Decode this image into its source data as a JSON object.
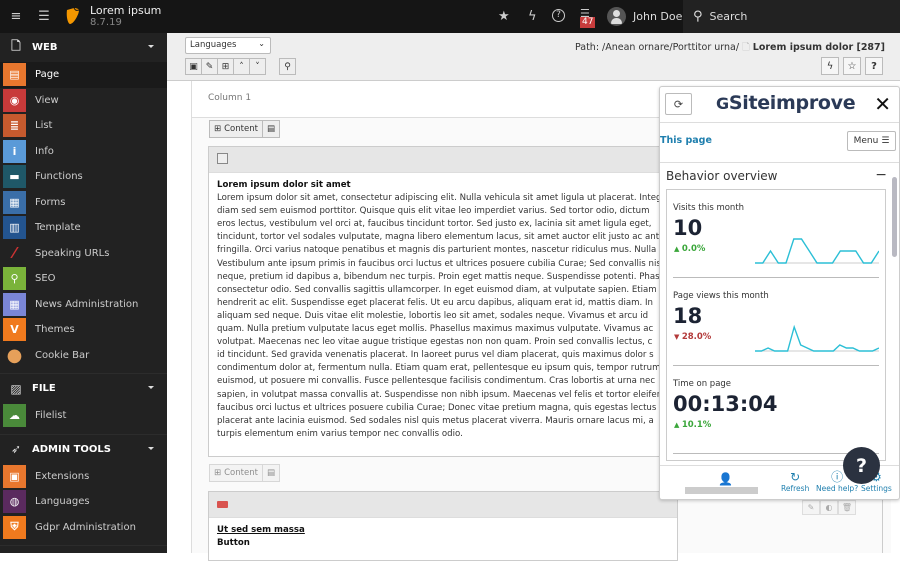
{
  "topbar": {
    "app_name": "Lorem ipsum",
    "version": "8.7.19",
    "notification_count": "47",
    "user_name": "John Doe",
    "search_label": "Search",
    "icons": [
      "menu-toggle-icon",
      "tree-toggle-icon",
      "bookmark-star-icon",
      "flash-icon",
      "help-icon",
      "system-info-icon",
      "avatar-icon",
      "search-icon"
    ]
  },
  "sidebar": {
    "sections": [
      {
        "label": "WEB",
        "icon": "page-icon",
        "items": [
          {
            "label": "Page",
            "icon": "page-module-icon",
            "color": "#e8772e",
            "active": true
          },
          {
            "label": "View",
            "icon": "eye-icon",
            "color": "#c83a3a"
          },
          {
            "label": "List",
            "icon": "list-icon",
            "color": "#c65a2e"
          },
          {
            "label": "Info",
            "icon": "info-icon",
            "color": "#5a9ad8"
          },
          {
            "label": "Functions",
            "icon": "briefcase-icon",
            "color": "#1f5868"
          },
          {
            "label": "Forms",
            "icon": "form-icon",
            "color": "#3a6ea8"
          },
          {
            "label": "Template",
            "icon": "template-icon",
            "color": "#23548f"
          },
          {
            "label": "Speaking URLs",
            "icon": "pill-icon",
            "color": "#222"
          },
          {
            "label": "SEO",
            "icon": "magnifier-icon",
            "color": "#7ab33a"
          },
          {
            "label": "News Administration",
            "icon": "newspaper-icon",
            "color": "#7a86d6"
          },
          {
            "label": "Themes",
            "icon": "typo3-icon",
            "color": "#f07a1e"
          },
          {
            "label": "Cookie Bar",
            "icon": "cookie-icon",
            "color": "#222"
          }
        ]
      },
      {
        "label": "FILE",
        "icon": "image-icon",
        "items": [
          {
            "label": "Filelist",
            "icon": "cloud-icon",
            "color": "#4a8a3a"
          }
        ]
      },
      {
        "label": "ADMIN TOOLS",
        "icon": "rocket-icon",
        "items": [
          {
            "label": "Extensions",
            "icon": "box-icon",
            "color": "#e8772e"
          },
          {
            "label": "Languages",
            "icon": "globe-icon",
            "color": "#5a2a5e"
          },
          {
            "label": "Gdpr Administration",
            "icon": "shield-lock-icon",
            "color": "#f07a1e"
          }
        ]
      }
    ]
  },
  "docheader": {
    "language_select": "Languages",
    "path_label": "Path: /Anean ornare/Porttitor urna/",
    "page_title": "Lorem ipsum dolor [287]",
    "help_label": "?"
  },
  "content": {
    "column_label": "Column 1",
    "new_content_label": "Content",
    "element1": {
      "header": "Lorem ipsum dolor sit amet",
      "lines": [
        "Lorem ipsum dolor sit amet, consectetur adipiscing elit. Nulla vehicula sit amet ligula ut placerat. Integer",
        "diam sed sem euismod porttitor. Quisque quis elit vitae leo imperdiet varius. Sed tortor odio, dictum",
        "eros lectus, vestibulum vel orci at, faucibus tincidunt tortor. Sed justo ex, lacinia sit amet ligula eget,",
        "tincidunt, tortor vel sodales vulputate, magna libero elementum lacus, sit amet auctor elit justo ac ante",
        "fringilla. Orci varius natoque penatibus et magnis dis parturient montes, nascetur ridiculus mus. Nulla",
        "Vestibulum ante ipsum primis in faucibus orci luctus et ultrices posuere cubilia Curae; Sed convallis nisl",
        "neque, pretium id dapibus a, bibendum nec turpis. Proin eget mattis neque. Suspendisse potenti. Phasellus",
        "consectetur odio. Sed convallis sagittis ullamcorper. In eget euismod diam, at vulputate sapien. Etiam",
        "hendrerit ac elit. Suspendisse eget placerat felis. Ut eu arcu dapibus, aliquam erat id, mattis diam. In",
        "aliquam sed neque. Duis vitae elit molestie, lobortis leo sit amet, sodales neque. Vivamus et arcu id",
        "quam. Nulla pretium vulputate lacus eget mollis. Phasellus maximus maximus vulputate. Vivamus ac",
        "volutpat. Maecenas nec leo vitae augue tristique egestas non non quam. Proin sed convallis lectus, c",
        "id tincidunt. Sed gravida venenatis placerat. In laoreet purus vel diam placerat, quis maximus dolor s",
        "condimentum dolor at, fermentum nulla. Etiam quam erat, pellentesque eu ipsum quis, tempor rutrum",
        "euismod, ut posuere mi convallis. Fusce pellentesque facilisis condimentum. Cras lobortis at urna nec",
        "sapien, in volutpat massa convallis at. Suspendisse non nibh ipsum. Maecenas vel felis et tortor eleifend",
        "faucibus orci luctus et ultrices posuere cubilia Curae; Donec vitae pretium magna, quis egestas lectus",
        "placerat ante lacinia euismod. Sed sodales nisl quis metus placerat viverra. Mauris ornare lacus mi, a",
        "turpis elementum enim varius tempor nec convallis odio."
      ]
    },
    "element2": {
      "header": "Ut sed sem massa",
      "subheader": "Button"
    }
  },
  "siteimprove": {
    "title": "Siteimprove",
    "tab_label": "This page",
    "menu_label": "Menu",
    "section_title": "Behavior overview",
    "metrics": [
      {
        "label": "Visits this month",
        "value": "10",
        "change": "0.0%",
        "direction": "up",
        "spark": [
          0,
          0,
          2,
          0,
          0,
          4,
          4,
          2,
          0,
          0,
          0,
          2,
          2,
          2,
          0,
          0,
          2
        ]
      },
      {
        "label": "Page views this month",
        "value": "18",
        "change": "28.0%",
        "direction": "down",
        "spark": [
          0,
          0,
          1,
          0,
          0,
          0,
          8,
          2,
          1,
          0,
          0,
          0,
          0,
          2,
          1,
          1,
          0,
          0,
          0,
          1
        ]
      },
      {
        "label": "Time on page",
        "value": "00:13:04",
        "change": "10.1%",
        "direction": "up",
        "spark": []
      }
    ],
    "footer": {
      "refresh_label": "Refresh",
      "help_label": "Need help?",
      "settings_label": "Settings"
    },
    "help_bubble": "?",
    "colors": {
      "accent": "#1f7fae",
      "spark": "#2bbfd6",
      "up": "#3aa63a",
      "down": "#b33a3a"
    }
  }
}
